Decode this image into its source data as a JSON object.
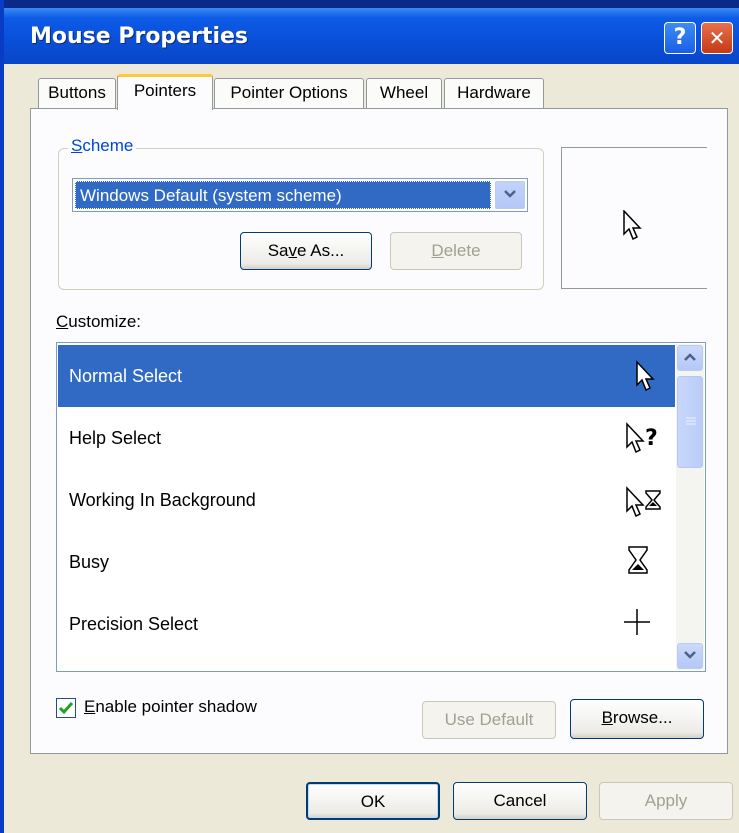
{
  "window": {
    "title": "Mouse Properties",
    "help_glyph": "?",
    "close_glyph": "✕"
  },
  "tabs": [
    {
      "label": "Buttons",
      "active": false
    },
    {
      "label": "Pointers",
      "active": true
    },
    {
      "label": "Pointer Options",
      "active": false
    },
    {
      "label": "Wheel",
      "active": false
    },
    {
      "label": "Hardware",
      "active": false
    }
  ],
  "scheme": {
    "group_label": "Scheme",
    "selected_value": "Windows Default (system scheme)",
    "save_as_label": "Save As...",
    "delete_label": "Delete"
  },
  "preview": {
    "icon": "arrow-pointer-icon"
  },
  "customize": {
    "label": "Customize:",
    "items": [
      {
        "label": "Normal Select",
        "icon": "arrow-pointer-icon",
        "selected": true
      },
      {
        "label": "Help Select",
        "icon": "help-pointer-icon",
        "selected": false
      },
      {
        "label": "Working In Background",
        "icon": "working-pointer-icon",
        "selected": false
      },
      {
        "label": "Busy",
        "icon": "hourglass-icon",
        "selected": false
      },
      {
        "label": "Precision Select",
        "icon": "crosshair-icon",
        "selected": false
      },
      {
        "label": "",
        "icon": "text-select-icon",
        "selected": false
      }
    ]
  },
  "options": {
    "enable_shadow_label": "Enable pointer shadow",
    "enable_shadow_checked": true,
    "use_default_label": "Use Default",
    "browse_label": "Browse..."
  },
  "footer": {
    "ok_label": "OK",
    "cancel_label": "Cancel",
    "apply_label": "Apply"
  },
  "colors": {
    "titlebar": "#0a4fd8",
    "selection": "#316ac5",
    "tab_highlight": "#ffc83c"
  }
}
